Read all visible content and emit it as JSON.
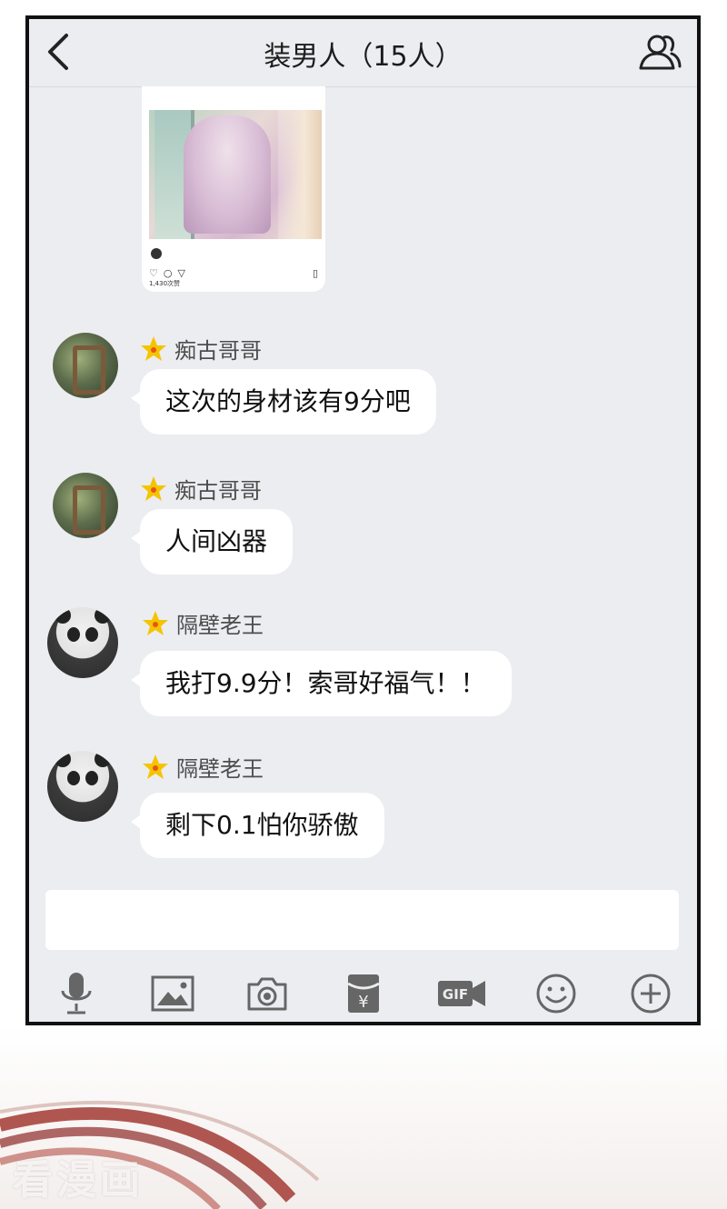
{
  "header": {
    "title": "装男人（15人）"
  },
  "shared_post": {
    "likes_text": "1,430次赞"
  },
  "messages": [
    {
      "sender": "痴古哥哥",
      "text": "这次的身材该有9分吧"
    },
    {
      "sender": "痴古哥哥",
      "text": "人间凶器"
    },
    {
      "sender": "隔壁老王",
      "text": "我打9.9分！索哥好福气！！"
    },
    {
      "sender": "隔壁老王",
      "text": "剩下0.1怕你骄傲"
    }
  ],
  "input": {
    "value": ""
  },
  "toolbar": {
    "icons": [
      "microphone-icon",
      "image-icon",
      "camera-icon",
      "red-packet-icon",
      "gif-icon",
      "emoji-icon",
      "plus-icon"
    ],
    "gif_label": "GIF",
    "red_packet_symbol": "¥"
  },
  "watermark": "看漫画",
  "colors": {
    "background": "#ecedf1",
    "bubble": "#ffffff",
    "icon": "#666666",
    "star": "#f5c400",
    "star_center": "#e8541e"
  }
}
